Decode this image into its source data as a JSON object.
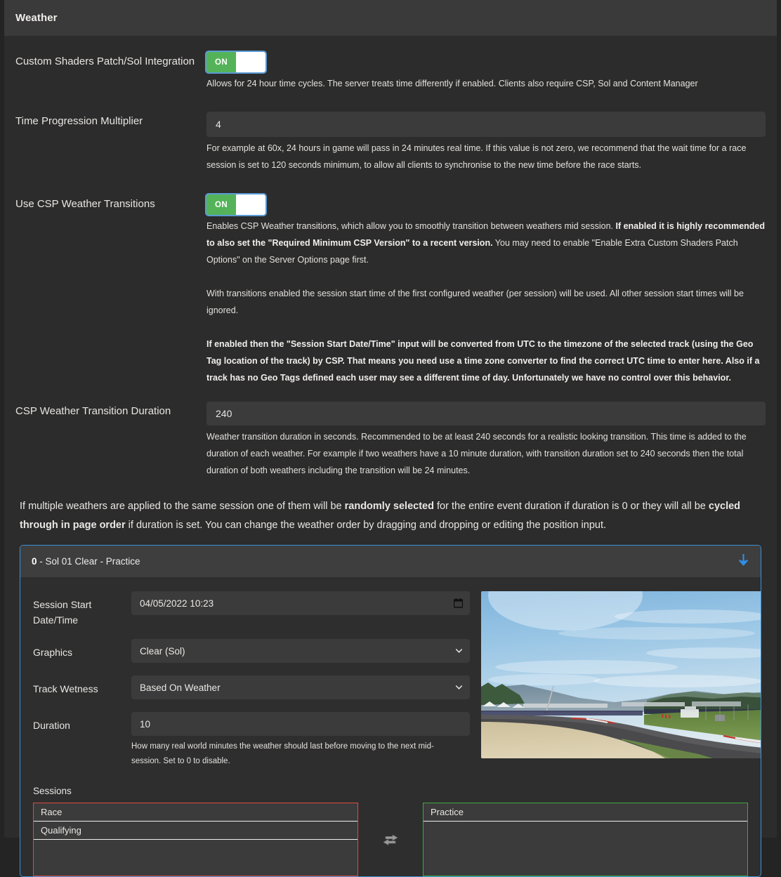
{
  "panel": {
    "title": "Weather"
  },
  "fields": {
    "csp_sol": {
      "label": "Custom Shaders Patch/Sol Integration",
      "toggle_state": "ON",
      "help": "Allows for 24 hour time cycles. The server treats time differently if enabled. Clients also require CSP, Sol and Content Manager"
    },
    "time_multiplier": {
      "label": "Time Progression Multiplier",
      "value": "4",
      "help": "For example at 60x, 24 hours in game will pass in 24 minutes real time. If this value is not zero, we recommend that the wait time for a race session is set to 120 seconds minimum, to allow all clients to synchronise to the new time before the race starts."
    },
    "csp_transitions": {
      "label": "Use CSP Weather Transitions",
      "toggle_state": "ON",
      "help_p1_a": "Enables CSP Weather transitions, which allow you to smoothly transition between weathers mid session. ",
      "help_p1_b": "If enabled it is highly recommended to also set the \"Required Minimum CSP Version\" to a recent version.",
      "help_p1_c": " You may need to enable \"Enable Extra Custom Shaders Patch Options\" on the Server Options page first.",
      "help_p2": "With transitions enabled the session start time of the first configured weather (per session) will be used. All other session start times will be ignored.",
      "help_p3": "If enabled then the \"Session Start Date/Time\" input will be converted from UTC to the timezone of the selected track (using the Geo Tag location of the track) by CSP. That means you need use a time zone converter to find the correct UTC time to enter here. Also if a track has no Geo Tags defined each user may see a different time of day. Unfortunately we have no control over this behavior."
    },
    "transition_duration": {
      "label": "CSP Weather Transition Duration",
      "value": "240",
      "help": "Weather transition duration in seconds. Recommended to be at least 240 seconds for a realistic looking transition. This time is added to the duration of each weather. For example if two weathers have a 10 minute duration, with transition duration set to 240 seconds then the total duration of both weathers including the transition will be 24 minutes."
    }
  },
  "note": {
    "a": "If multiple weathers are applied to the same session one of them will be ",
    "b": "randomly selected",
    "c": " for the entire event duration if duration is 0 or they will all be ",
    "d": "cycled through in page order",
    "e": " if duration is set. You can change the weather order by dragging and dropping or editing the position input."
  },
  "weather_card": {
    "position": "0",
    "title_rest": " - Sol 01 Clear - Practice",
    "collapse_icon": "arrow-down-icon",
    "session_start": {
      "label": "Session Start Date/Time",
      "value": "04/05/2022 10:23",
      "icon": "calendar-icon"
    },
    "graphics": {
      "label": "Graphics",
      "selected": "Clear (Sol)",
      "options": [
        "Clear (Sol)"
      ]
    },
    "track_wetness": {
      "label": "Track Wetness",
      "selected": "Based On Weather",
      "options": [
        "Based On Weather"
      ]
    },
    "duration": {
      "label": "Duration",
      "value": "10",
      "help": "How many real world minutes the weather should last before moving to the next mid-session. Set to 0 to disable."
    },
    "sessions": {
      "label": "Sessions",
      "available": [
        "Race",
        "Qualifying"
      ],
      "selected": [
        "Practice"
      ],
      "swap_icon": "exchange-arrows-icon"
    }
  },
  "colors": {
    "accent_blue": "#3a92d6",
    "toggle_green": "#54b359",
    "list_red": "#e04a43",
    "list_green": "#3fa83f",
    "arrow_blue": "#2e8fe8"
  }
}
